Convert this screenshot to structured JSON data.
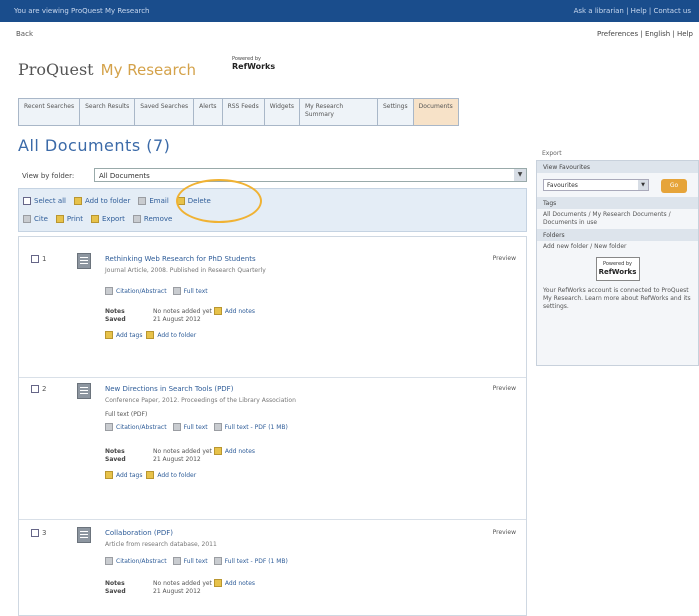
{
  "topbar": {
    "left_text": "You are viewing ProQuest My Research",
    "right_text": "Ask a librarian | Help | Contact us"
  },
  "nav": {
    "back_label": "Back",
    "top_links": "Preferences | English | Help"
  },
  "brand": {
    "logo_pro": "ProQuest",
    "logo_my": "My Research",
    "powered_by": "Powered by",
    "powered_brand": "RefWorks"
  },
  "tabs": [
    {
      "label": "Recent Searches",
      "active": false
    },
    {
      "label": "Search Results",
      "active": false
    },
    {
      "label": "Saved Searches",
      "active": false
    },
    {
      "label": "Alerts",
      "active": false
    },
    {
      "label": "RSS Feeds",
      "active": false
    },
    {
      "label": "Widgets",
      "active": false
    },
    {
      "label": "My Research Summary",
      "active": false
    },
    {
      "label": "Settings",
      "active": false
    },
    {
      "label": "Documents",
      "active": true
    }
  ],
  "page_title": "All Documents (7)",
  "viewbar": {
    "label": "View by folder:",
    "selected": "All Documents"
  },
  "actions": {
    "row1": [
      "Select all",
      "Add to folder",
      "Email",
      "Delete"
    ],
    "row2": [
      "Cite",
      "Print",
      "Export",
      "Remove"
    ]
  },
  "documents": [
    {
      "num": "1",
      "title": "Rethinking Web Research for PhD Students",
      "meta": "Journal Article, 2008. Published in Research Quarterly",
      "links": [
        "Citation/Abstract",
        "Full text"
      ],
      "notes_label": "Notes",
      "notes_value": "No notes added yet",
      "add_notes": "Add notes",
      "saved_label": "Saved",
      "saved_value": "21 August 2012",
      "tags_label": "Add tags",
      "add_tags": "Add to folder",
      "preview": "Preview"
    },
    {
      "num": "2",
      "title": "New Directions in Search Tools (PDF)",
      "meta": "Conference Paper, 2012. Proceedings of the Library Association",
      "extra": "Full text (PDF)",
      "links": [
        "Citation/Abstract",
        "Full text",
        "Full text - PDF (1 MB)"
      ],
      "notes_label": "Notes",
      "notes_value": "No notes added yet",
      "add_notes": "Add notes",
      "saved_label": "Saved",
      "saved_value": "21 August 2012",
      "tags_label": "Add tags",
      "add_tags": "Add to folder",
      "preview": "Preview"
    },
    {
      "num": "3",
      "title": "Collaboration (PDF)",
      "meta": "Article from research database, 2011",
      "links": [
        "Citation/Abstract",
        "Full text",
        "Full text - PDF (1 MB)"
      ],
      "notes_label": "Notes",
      "notes_value": "No notes added yet",
      "add_notes": "Add notes",
      "saved_label": "Saved",
      "saved_value": "21 August 2012",
      "preview": "Preview"
    }
  ],
  "sidebar": {
    "top": "Export",
    "head": "View Favourites",
    "select_value": "Favourites",
    "go_label": "Go",
    "tags_head": "Tags",
    "tags_text": "All Documents / My Research Documents / Documents in use",
    "folders_head": "Folders",
    "folders_text": "Add new folder / New folder",
    "badge_top": "Powered by",
    "badge_brand": "RefWorks",
    "footer_text": "Your RefWorks account is connected to ProQuest My Research. Learn more about RefWorks and its settings."
  },
  "colors": {
    "topbar": "#1a4d8c",
    "title": "#3b6aa8",
    "accent": "#d4a24a",
    "highlight": "#f0b233"
  }
}
